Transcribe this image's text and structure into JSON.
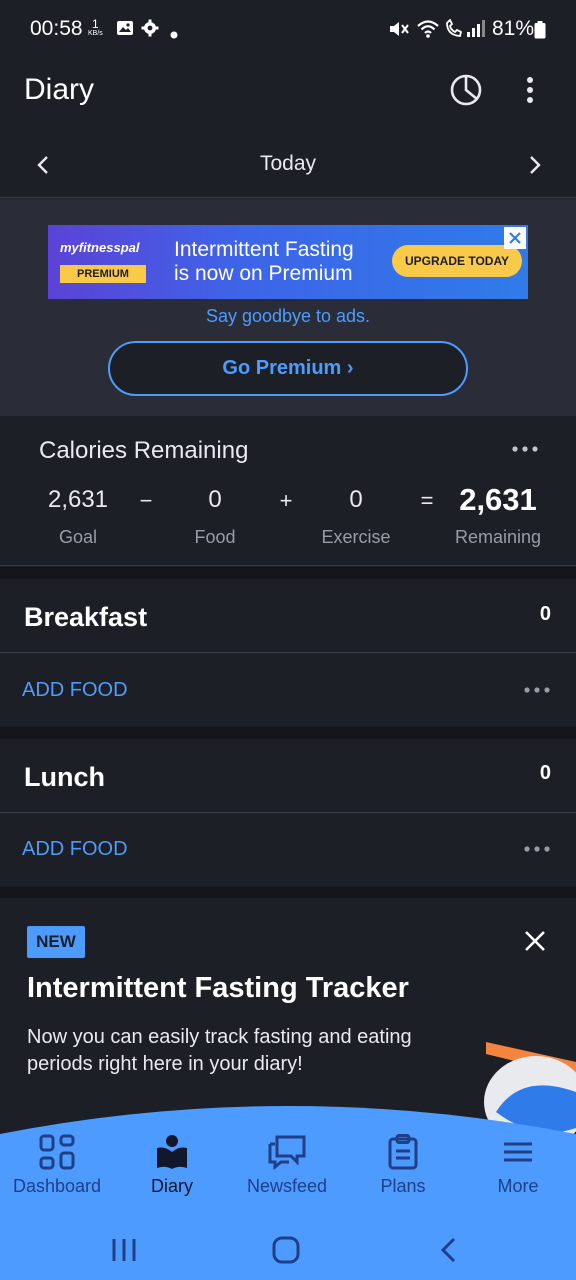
{
  "status_bar": {
    "time": "00:58",
    "net_speed_value": "1",
    "net_speed_unit": "KB/s",
    "battery": "81%"
  },
  "appbar": {
    "title": "Diary"
  },
  "date_nav": {
    "label": "Today"
  },
  "ad": {
    "logo": "myfitnesspal",
    "badge": "PREMIUM",
    "headline_line1": "Intermittent Fasting",
    "headline_line2": "is now on Premium",
    "cta": "UPGRADE TODAY",
    "subtext": "Say goodbye to ads.",
    "go_premium": "Go Premium ›"
  },
  "calories": {
    "title": "Calories Remaining",
    "goal_value": "2,631",
    "goal_label": "Goal",
    "minus": "−",
    "food_value": "0",
    "food_label": "Food",
    "plus": "+",
    "exercise_value": "0",
    "exercise_label": "Exercise",
    "equals": "=",
    "remaining_value": "2,631",
    "remaining_label": "Remaining"
  },
  "meals": [
    {
      "name": "Breakfast",
      "calories": "0",
      "add_label": "ADD FOOD"
    },
    {
      "name": "Lunch",
      "calories": "0",
      "add_label": "ADD FOOD"
    }
  ],
  "promo": {
    "badge": "NEW",
    "title": "Intermittent Fasting Tracker",
    "body": "Now you can easily track fasting and eating periods right here in your diary!"
  },
  "bottom_nav": {
    "items": [
      {
        "label": "Dashboard",
        "icon": "dashboard-icon"
      },
      {
        "label": "Diary",
        "icon": "diary-icon",
        "active": true
      },
      {
        "label": "Newsfeed",
        "icon": "newsfeed-icon"
      },
      {
        "label": "Plans",
        "icon": "plans-icon"
      },
      {
        "label": "More",
        "icon": "menu-icon"
      }
    ]
  },
  "colors": {
    "background": "#1d1f27",
    "accent": "#4e9bff",
    "ad_yellow": "#f9c94a",
    "nav_bg": "#4e9bff"
  }
}
